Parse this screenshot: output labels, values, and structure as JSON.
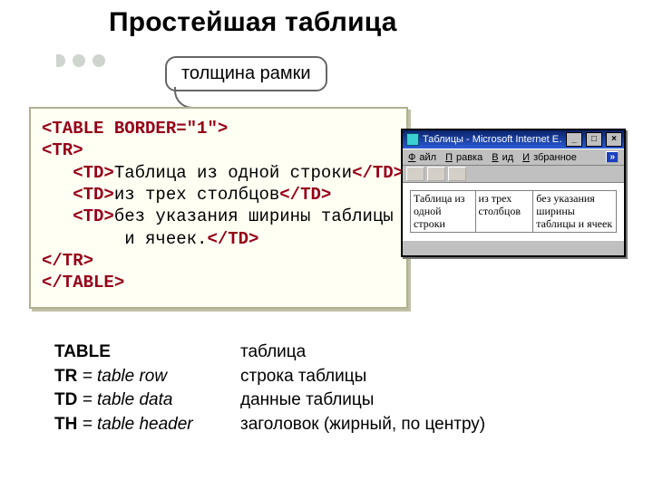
{
  "title": "Простейшая таблица",
  "callout": "толщина рамки",
  "code": {
    "l1_open": "<TABLE",
    "l1_attr": " BORDER=\"1\"",
    "l1_close": ">",
    "l2": "<TR>",
    "l3_open": "   <TD>",
    "l3_text": "Таблица из одной строки",
    "l3_close": "</TD>",
    "l4_open": "   <TD>",
    "l4_text": "из трех столбцов",
    "l4_close": "</TD>",
    "l5_open": "   <TD>",
    "l5_text": "без указания ширины таблицы",
    "l6_text": "        и ячеек.",
    "l6_close": "</TD>",
    "l7": "</TR>",
    "l8": "</TABLE>"
  },
  "browser": {
    "window_title": "Таблицы - Microsoft Internet E…",
    "menus": {
      "file": {
        "u": "Ф",
        "rest": "айл"
      },
      "edit": {
        "u": "П",
        "rest": "равка"
      },
      "view": {
        "u": "В",
        "rest": "ид"
      },
      "fav": {
        "u": "И",
        "rest": "збранное"
      }
    },
    "chevrons": "»",
    "cells": {
      "c1": "Таблица из одной строки",
      "c2": "из трех столбцов",
      "c3": "без указания ширины таблицы и ячеек"
    }
  },
  "definitions": [
    {
      "term_bold": "TABLE",
      "term_rest": "",
      "desc": "таблица"
    },
    {
      "term_bold": "TR",
      "term_rest": " = table row",
      "desc": "строка таблицы"
    },
    {
      "term_bold": "TD",
      "term_rest": " = table data",
      "desc": "данные таблицы"
    },
    {
      "term_bold": "TH",
      "term_rest": " = table header",
      "desc": "заголовок (жирный, по центру)"
    }
  ]
}
